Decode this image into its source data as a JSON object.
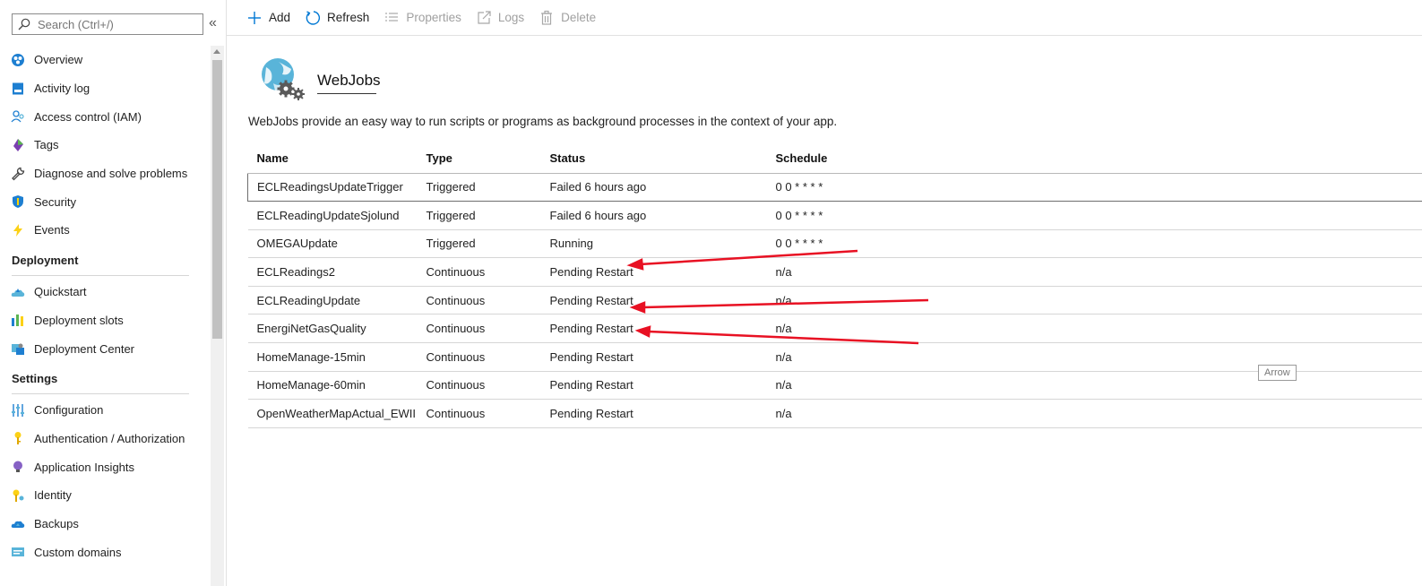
{
  "sidebar": {
    "search_placeholder": "Search (Ctrl+/)",
    "collapse_glyph": "«",
    "groups": [
      {
        "header": "",
        "items": [
          {
            "label": "Overview",
            "icon": "overview-icon"
          },
          {
            "label": "Activity log",
            "icon": "activity-log-icon"
          },
          {
            "label": "Access control (IAM)",
            "icon": "access-control-icon"
          },
          {
            "label": "Tags",
            "icon": "tag-icon"
          },
          {
            "label": "Diagnose and solve problems",
            "icon": "wrench-icon"
          },
          {
            "label": "Security",
            "icon": "shield-icon"
          },
          {
            "label": "Events",
            "icon": "lightning-icon"
          }
        ]
      },
      {
        "header": "Deployment",
        "items": [
          {
            "label": "Quickstart",
            "icon": "cloud-rocket-icon"
          },
          {
            "label": "Deployment slots",
            "icon": "slots-icon"
          },
          {
            "label": "Deployment Center",
            "icon": "deployment-center-icon"
          }
        ]
      },
      {
        "header": "Settings",
        "items": [
          {
            "label": "Configuration",
            "icon": "sliders-icon"
          },
          {
            "label": "Authentication / Authorization",
            "icon": "key-icon"
          },
          {
            "label": "Application Insights",
            "icon": "lightbulb-icon"
          },
          {
            "label": "Identity",
            "icon": "identity-key-icon"
          },
          {
            "label": "Backups",
            "icon": "cloud-backup-icon"
          },
          {
            "label": "Custom domains",
            "icon": "domain-icon"
          }
        ]
      }
    ]
  },
  "toolbar": {
    "add": "Add",
    "refresh": "Refresh",
    "properties": "Properties",
    "logs": "Logs",
    "delete": "Delete"
  },
  "main": {
    "title": "WebJobs",
    "description": "WebJobs provide an easy way to run scripts or programs as background processes in the context of your app.",
    "columns": [
      "Name",
      "Type",
      "Status",
      "Schedule"
    ],
    "rows": [
      [
        "ECLReadingsUpdateTrigger",
        "Triggered",
        "Failed 6 hours ago",
        "0 0 * * * *"
      ],
      [
        "ECLReadingUpdateSjolund",
        "Triggered",
        "Failed 6 hours ago",
        "0 0 * * * *"
      ],
      [
        "OMEGAUpdate",
        "Triggered",
        "Running",
        "0 0 * * * *"
      ],
      [
        "ECLReadings2",
        "Continuous",
        "Pending Restart",
        "n/a"
      ],
      [
        "ECLReadingUpdate",
        "Continuous",
        "Pending Restart",
        "n/a"
      ],
      [
        "EnergiNetGasQuality",
        "Continuous",
        "Pending Restart",
        "n/a"
      ],
      [
        "HomeManage-15min",
        "Continuous",
        "Pending Restart",
        "n/a"
      ],
      [
        "HomeManage-60min",
        "Continuous",
        "Pending Restart",
        "n/a"
      ],
      [
        "OpenWeatherMapActual_EWII",
        "Continuous",
        "Pending Restart",
        "n/a"
      ]
    ],
    "selected_row": 0
  },
  "tooltip": "Arrow",
  "colors": {
    "accent": "#0078d4",
    "annotation_arrow": "#e81123"
  }
}
